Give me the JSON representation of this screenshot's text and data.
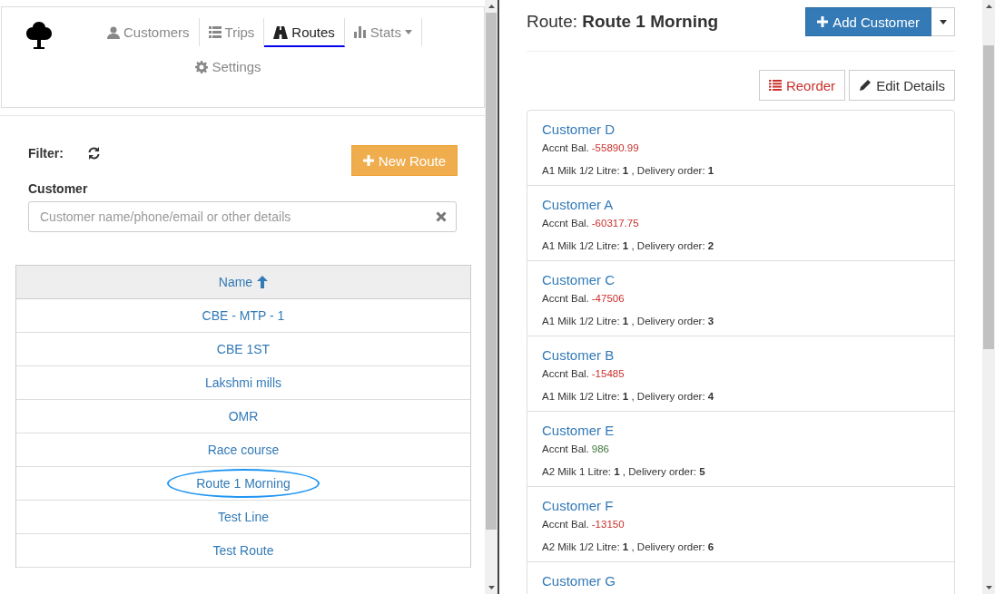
{
  "nav": {
    "tabs": [
      {
        "label": "Customers",
        "selected": false
      },
      {
        "label": "Trips",
        "selected": false
      },
      {
        "label": "Routes",
        "selected": true
      },
      {
        "label": "Stats",
        "selected": false
      },
      {
        "label": "Settings",
        "selected": false
      }
    ]
  },
  "filter": {
    "label": "Filter:",
    "new_button": "New Route",
    "field_label": "Customer",
    "placeholder": "Customer name/phone/email or other details"
  },
  "routes_table": {
    "column": "Name",
    "rows": [
      {
        "name": "CBE - MTP - 1",
        "selected": false
      },
      {
        "name": "CBE 1ST",
        "selected": false
      },
      {
        "name": "Lakshmi mills",
        "selected": false
      },
      {
        "name": "OMR",
        "selected": false
      },
      {
        "name": "Race course",
        "selected": false
      },
      {
        "name": "Route 1 Morning",
        "selected": true
      },
      {
        "name": "Test Line",
        "selected": false
      },
      {
        "name": "Test Route",
        "selected": false
      }
    ]
  },
  "route": {
    "title_prefix": "Route:",
    "title": "Route 1 Morning",
    "add_button": "Add Customer",
    "reorder_button": "Reorder",
    "edit_button": "Edit Details"
  },
  "customers": [
    {
      "name": "Customer D",
      "balance_label": "Accnt Bal.",
      "balance": "-55890.99",
      "color": "#c9302c",
      "details": "A1 Milk 1/2 Litre: **1** , Delivery order: **1**"
    },
    {
      "name": "Customer A",
      "balance_label": "Accnt Bal.",
      "balance": "-60317.75",
      "color": "#c9302c",
      "details": "A1 Milk 1/2 Litre: **1** , Delivery order: **2**"
    },
    {
      "name": "Customer C",
      "balance_label": "Accnt Bal.",
      "balance": "-47506",
      "color": "#c9302c",
      "details": "A1 Milk 1/2 Litre: **1** , Delivery order: **3**"
    },
    {
      "name": "Customer B",
      "balance_label": "Accnt Bal.",
      "balance": "-15485",
      "color": "#c9302c",
      "details": "A1 Milk 1/2 Litre: **1** , Delivery order: **4**"
    },
    {
      "name": "Customer E",
      "balance_label": "Accnt Bal.",
      "balance": "986",
      "color": "#3c763d",
      "details": "A2 Milk 1 Litre: **1** , Delivery order: **5**"
    },
    {
      "name": "Customer F",
      "balance_label": "Accnt Bal.",
      "balance": "-13150",
      "color": "#c9302c",
      "details": "A2 Milk 1/2 Litre: **1** , Delivery order: **6**"
    },
    {
      "name": "Customer G"
    }
  ]
}
